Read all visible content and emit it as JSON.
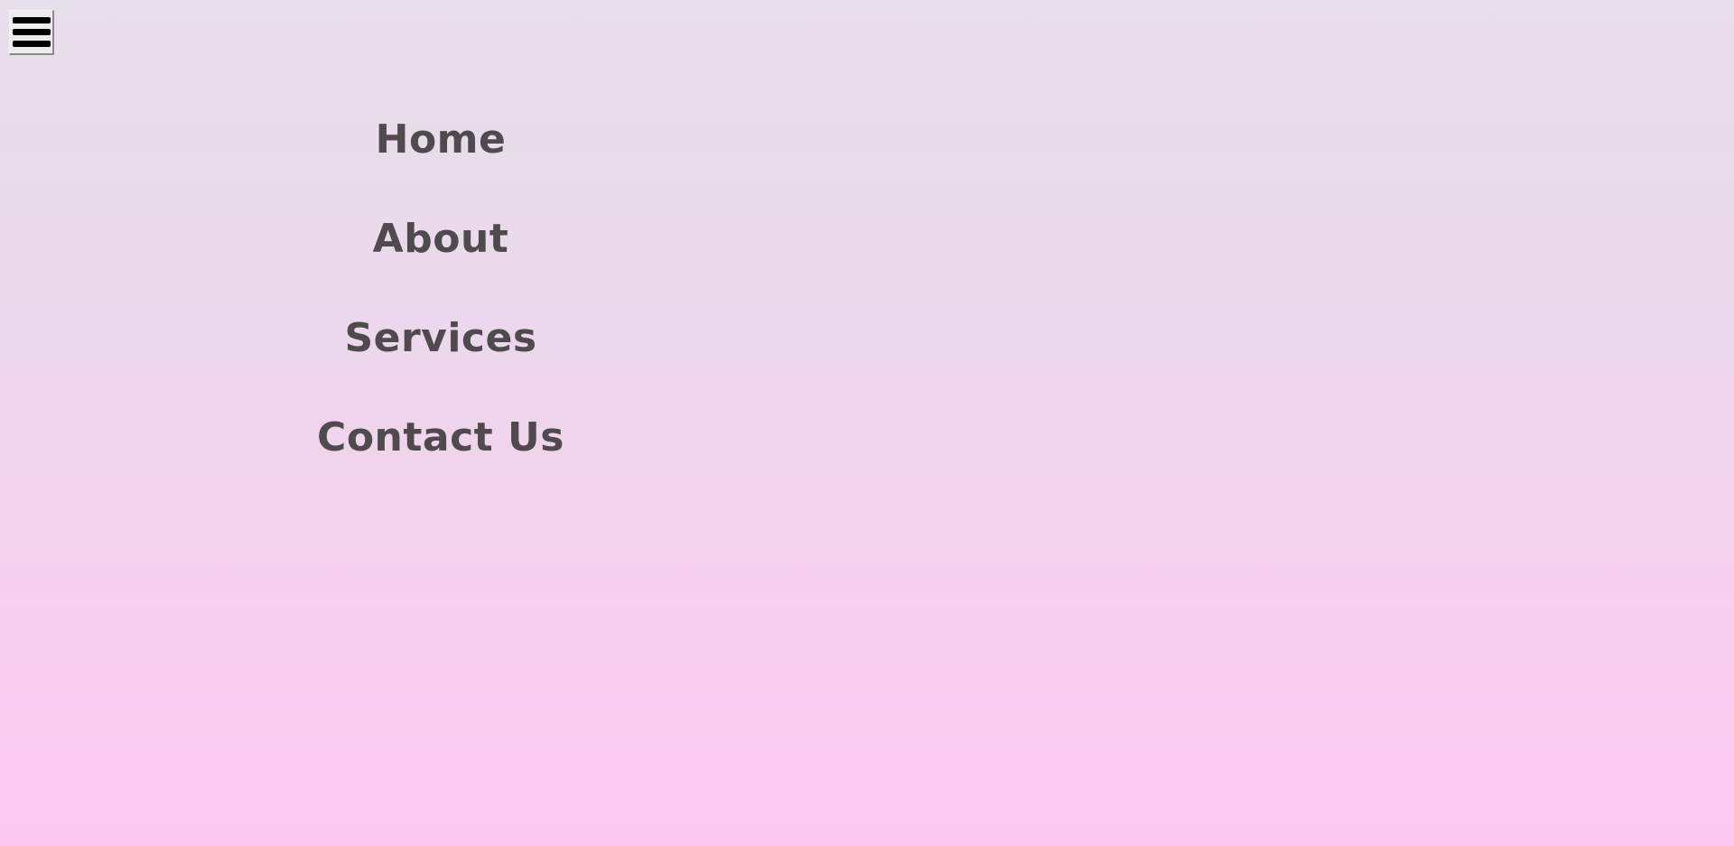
{
  "menu_toggle": {
    "icon": "hamburger-menu-icon"
  },
  "nav": {
    "items": [
      {
        "label": "Home"
      },
      {
        "label": "About"
      },
      {
        "label": "Services"
      },
      {
        "label": "Contact Us"
      }
    ]
  },
  "colors": {
    "background_top": "#e7dfe9",
    "background_bottom": "#fbc9f0",
    "link_text": "#4f4a4e",
    "toggle_background": "#ececec"
  }
}
